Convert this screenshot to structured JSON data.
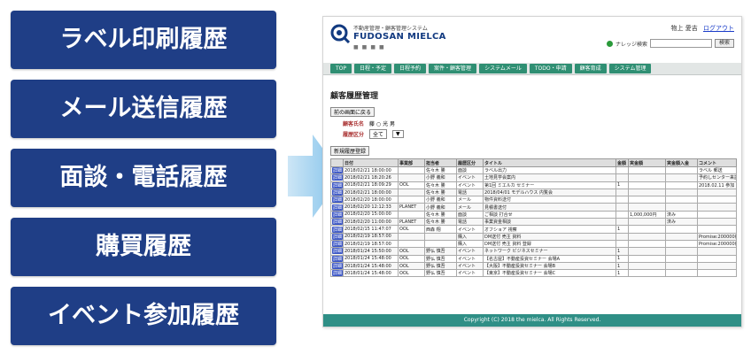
{
  "menu": {
    "items": [
      {
        "label": "ラベル印刷履歴"
      },
      {
        "label": "メール送信履歴"
      },
      {
        "label": "面談・電話履歴"
      },
      {
        "label": "購買履歴"
      },
      {
        "label": "イベント参加履歴"
      }
    ],
    "color": "#1f3e86"
  },
  "app": {
    "subtitle": "不動産管理・顧客管理システム",
    "name": "FUDOSAN MIELCA",
    "user": "物上 愛吉",
    "logout": "ログアウト",
    "search_label": "ナレッジ検索",
    "search_button": "検索"
  },
  "nav": {
    "tabs": [
      {
        "label": "TOP"
      },
      {
        "label": "日程・予定"
      },
      {
        "label": "日程予約"
      },
      {
        "label": "案件・顧客管理"
      },
      {
        "label": "システムメール"
      },
      {
        "label": "TODO・申請"
      },
      {
        "label": "顧客育成"
      },
      {
        "label": "システム管理"
      }
    ]
  },
  "page": {
    "title": "顧客履歴管理",
    "back_button": "前の画面に戻る",
    "filter_name_label": "顧客氏名",
    "filter_name_value": "藤 ○ 光 男",
    "filter_type_label": "履歴区分",
    "filter_type_value": "全て",
    "new_button": "新規履歴登録"
  },
  "table": {
    "headers": [
      "",
      "日付",
      "事業部",
      "担当者",
      "履歴区分",
      "タイトル",
      "金額",
      "実金額",
      "実金額入金",
      "コメント"
    ],
    "detail_label": "詳細",
    "rows": [
      {
        "date": "2018/02/21 18:00:00",
        "dept": "",
        "staff": "佐々木 勝",
        "kind": "面談",
        "title": "ラベル出力",
        "amount": "",
        "paid": "",
        "received": "",
        "comment": "ラベル 郵送"
      },
      {
        "date": "2018/02/21 18:20:26",
        "dept": "",
        "staff": "小野 義和",
        "kind": "イベント",
        "title": "土地見学会案内",
        "amount": "",
        "paid": "",
        "received": "",
        "comment": "予約しセンター来訪"
      },
      {
        "date": "2018/02/21 18:09:29",
        "dept": "OOL",
        "staff": "佐々木 勝",
        "kind": "イベント",
        "title": "第1回 ミエルカ セミナー",
        "amount": "1",
        "paid": "",
        "received": "",
        "comment": "2018.02.11 参加"
      },
      {
        "date": "2018/02/21 18:00:00",
        "dept": "",
        "staff": "佐々木 勝",
        "kind": "電話",
        "title": "2018/04/01 モデルハウス 内覧会",
        "amount": "",
        "paid": "",
        "received": "",
        "comment": ""
      },
      {
        "date": "2018/02/20 18:00:00",
        "dept": "",
        "staff": "小野 義和",
        "kind": "メール",
        "title": "物件資料送付",
        "amount": "",
        "paid": "",
        "received": "",
        "comment": ""
      },
      {
        "date": "2018/02/20 12:12:33",
        "dept": "PLANET",
        "staff": "小野 義和",
        "kind": "メール",
        "title": "見積書送付",
        "amount": "",
        "paid": "",
        "received": "",
        "comment": ""
      },
      {
        "date": "2018/02/20 15:00:00",
        "dept": "",
        "staff": "佐々木 勝",
        "kind": "面談",
        "title": "ご相談 打合せ",
        "amount": "",
        "paid": "1,000,000円",
        "received": "済み",
        "comment": ""
      },
      {
        "date": "2018/02/20 11:00:00",
        "dept": "PLANET",
        "staff": "佐々木 勝",
        "kind": "電話",
        "title": "事業資金相談",
        "amount": "",
        "paid": "",
        "received": "済み",
        "comment": ""
      },
      {
        "date": "2018/02/15 11:47:07",
        "dept": "OOL",
        "staff": "西森 翔",
        "kind": "イベント",
        "title": "オフショア 視察",
        "amount": "1",
        "paid": "",
        "received": "",
        "comment": ""
      },
      {
        "date": "2018/02/19 18:57:00",
        "dept": "",
        "staff": "",
        "kind": "購入",
        "title": "DM送付 売主 資料",
        "amount": "",
        "paid": "",
        "received": "",
        "comment": "Promise:200000円"
      },
      {
        "date": "2018/02/19 18:57:00",
        "dept": "",
        "staff": "",
        "kind": "購入",
        "title": "DM送付 売主 資料 登録",
        "amount": "",
        "paid": "",
        "received": "",
        "comment": "Promise:200000円"
      },
      {
        "date": "2018/01/24 15:50:00",
        "dept": "OOL",
        "staff": "野仏 慎吾",
        "kind": "イベント",
        "title": "ネットワーク ビジネスセミナー",
        "amount": "1",
        "paid": "",
        "received": "",
        "comment": ""
      },
      {
        "date": "2018/01/24 15:48:00",
        "dept": "OOL",
        "staff": "野仏 慎吾",
        "kind": "イベント",
        "title": "【名古屋】不動産投資セミナー 会場A",
        "amount": "1",
        "paid": "",
        "received": "",
        "comment": ""
      },
      {
        "date": "2018/01/24 15:48:00",
        "dept": "OOL",
        "staff": "野仏 慎吾",
        "kind": "イベント",
        "title": "【大阪】不動産投資セミナー 会場B",
        "amount": "1",
        "paid": "",
        "received": "",
        "comment": ""
      },
      {
        "date": "2018/01/24 15:48:00",
        "dept": "OOL",
        "staff": "野仏 慎吾",
        "kind": "イベント",
        "title": "【東京】不動産投資セミナー 会場C",
        "amount": "1",
        "paid": "",
        "received": "",
        "comment": ""
      }
    ]
  },
  "footer": {
    "copyright": "Copyright (C) 2018 the mielca. All Rights Reserved."
  },
  "colors": {
    "menu_bg": "#1f3e86",
    "tab_bg": "#2f8f73",
    "footer_bg": "#2f8f86",
    "arrow": "#8fc8ea"
  }
}
